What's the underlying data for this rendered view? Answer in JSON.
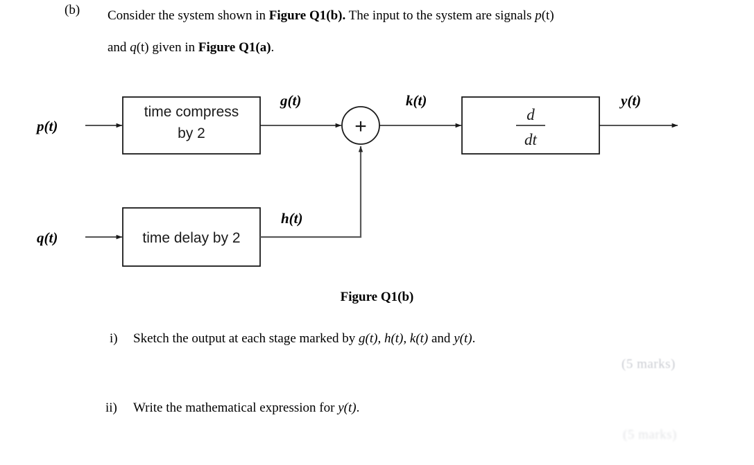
{
  "question": {
    "part_label": "(b)",
    "line1_pre": "Consider the system shown in ",
    "line1_bold": "Figure Q1(b).",
    "line1_post": " The input to the system are signals ",
    "line1_var_p": "p",
    "line1_var_t1": "(t)",
    "line2_pre": "and ",
    "line2_var_q": "q",
    "line2_var_t2": "(t)",
    "line2_mid": " given in ",
    "line2_bold": "Figure Q1(a)",
    "line2_post": "."
  },
  "diagram": {
    "caption": "Figure Q1(b)",
    "input_p": "p(t)",
    "input_q": "q(t)",
    "block_compress_line1": "time compress",
    "block_compress_line2": "by 2",
    "block_delay": "time delay by 2",
    "block_derivative_num": "d",
    "block_derivative_den": "dt",
    "sum_symbol": "+",
    "signal_g": "g(t)",
    "signal_h": "h(t)",
    "signal_k": "k(t)",
    "signal_y": "y(t)",
    "stroke_color": "#1a1a1a",
    "line_color": "#595959"
  },
  "subquestions": [
    {
      "marker": "i)",
      "text_pre": "Sketch the output at each stage marked by ",
      "vars": "g(t), h(t), k(t)",
      "text_mid": " and ",
      "var_last": "y(t)",
      "text_post": ".",
      "marks": "(5 marks)"
    },
    {
      "marker": "ii)",
      "text_pre": "Write the mathematical expression for ",
      "var_last": "y(t)",
      "text_post": ".",
      "marks": "(5 marks)"
    }
  ]
}
